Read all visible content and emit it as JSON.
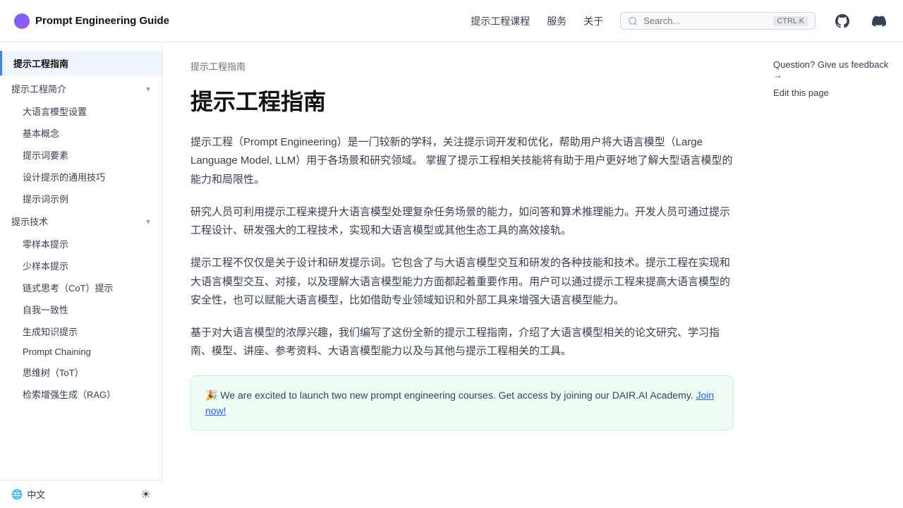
{
  "topnav": {
    "logo_text": "Prompt Engineering Guide",
    "nav_items": [
      {
        "label": "提示工程课程"
      },
      {
        "label": "服务"
      },
      {
        "label": "关于"
      }
    ],
    "search_placeholder": "Search...",
    "search_shortcut": "CTRL K"
  },
  "sidebar": {
    "active_section": "提示工程指南",
    "items": [
      {
        "label": "提示工程指南",
        "type": "section"
      },
      {
        "label": "提示工程简介",
        "type": "item",
        "expandable": true
      },
      {
        "label": "大语言模型设置",
        "type": "subitem"
      },
      {
        "label": "基本概念",
        "type": "subitem"
      },
      {
        "label": "提示词要素",
        "type": "subitem"
      },
      {
        "label": "设计提示的通用技巧",
        "type": "subitem"
      },
      {
        "label": "提示词示例",
        "type": "subitem"
      },
      {
        "label": "提示技术",
        "type": "item",
        "expandable": true
      },
      {
        "label": "零样本提示",
        "type": "subitem"
      },
      {
        "label": "少样本提示",
        "type": "subitem"
      },
      {
        "label": "链式思考（CoT）提示",
        "type": "subitem"
      },
      {
        "label": "自我一致性",
        "type": "subitem"
      },
      {
        "label": "生成知识提示",
        "type": "subitem"
      },
      {
        "label": "Prompt Chaining",
        "type": "subitem"
      },
      {
        "label": "思维树（ToT）",
        "type": "subitem"
      },
      {
        "label": "检索增强生成（RAG）",
        "type": "subitem"
      }
    ],
    "bottom": {
      "language": "中文",
      "theme_icon": "☀"
    }
  },
  "breadcrumb": "提示工程指南",
  "page": {
    "title": "提示工程指南",
    "paragraphs": [
      "提示工程（Prompt Engineering）是一门较新的学科，关注提示词开发和优化，帮助用户将大语言模型（Large Language Model, LLM）用于各场景和研究领域。 掌握了提示工程相关技能将有助于用户更好地了解大型语言模型的能力和局限性。",
      "研究人员可利用提示工程来提升大语言模型处理复杂任务场景的能力，如问答和算术推理能力。开发人员可通过提示工程设计、研发强大的工程技术，实现和大语言模型或其他生态工具的高效接轨。",
      "提示工程不仅仅是关于设计和研发提示词。它包含了与大语言模型交互和研发的各种技能和技术。提示工程在实现和大语言模型交互、对接，以及理解大语言模型能力方面都起着重要作用。用户可以通过提示工程来提高大语言模型的安全性，也可以赋能大语言模型，比如借助专业领域知识和外部工具来增强大语言模型能力。",
      "基于对大语言模型的浓厚兴趣，我们编写了这份全新的提示工程指南，介绍了大语言模型相关的论文研究、学习指南、模型、讲座、参考资料、大语言模型能力以及与其他与提示工程相关的工具。"
    ],
    "notice": {
      "emoji": "🎉",
      "text": "We are excited to launch two new prompt engineering courses. Get access by joining our DAIR.AI Academy.",
      "link_text": "Join now!",
      "link_url": "#"
    }
  },
  "right_sidebar": {
    "links": [
      {
        "label": "Question? Give us feedback →"
      },
      {
        "label": "Edit this page"
      }
    ]
  }
}
